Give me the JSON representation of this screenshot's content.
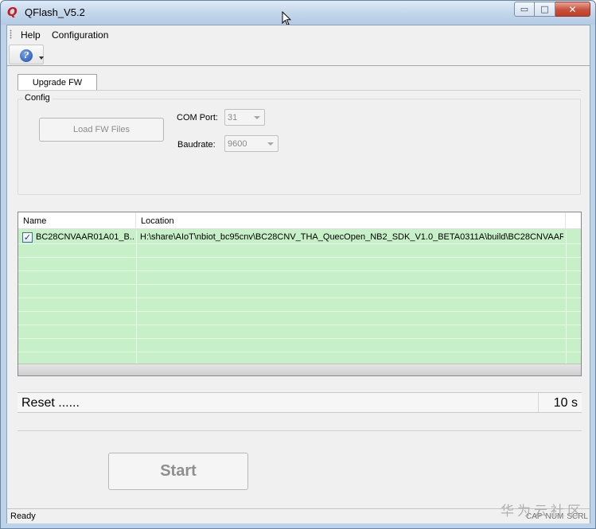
{
  "window": {
    "title": "QFlash_V5.2",
    "logo_letter": "Q",
    "close_glyph": "✕",
    "min_glyph": "▭",
    "max_glyph": "□"
  },
  "menu": {
    "items": [
      "Help",
      "Configuration"
    ]
  },
  "toolbar": {
    "help_glyph": "?"
  },
  "tabs": [
    {
      "label": "Upgrade FW"
    }
  ],
  "config": {
    "legend": "Config",
    "load_button": "Load FW Files",
    "com_port_label": "COM Port:",
    "com_port_value": "31",
    "baudrate_label": "Baudrate:",
    "baudrate_value": "9600"
  },
  "filelist": {
    "columns": [
      "Name",
      "Location"
    ],
    "rows": [
      {
        "checked": true,
        "check_glyph": "✓",
        "name": "BC28CNVAAR01A01_B...",
        "location": "H:\\share\\AIoT\\nbiot_bc95cnv\\BC28CNV_THA_QuecOpen_NB2_SDK_V1.0_BETA0311A\\build\\BC28CNVAAR..."
      }
    ],
    "empty_rows": 10
  },
  "status_line": {
    "text": "Reset ......",
    "time": "10 s"
  },
  "start_button": "Start",
  "statusbar": {
    "text": "Ready",
    "indicators": [
      "CAP",
      "NUM",
      "SCRL"
    ]
  },
  "watermark": "华为云社区",
  "colors": {
    "list_bg": "#c8f0c8",
    "accent": "#1c47a8",
    "close_red": "#c7503a"
  }
}
